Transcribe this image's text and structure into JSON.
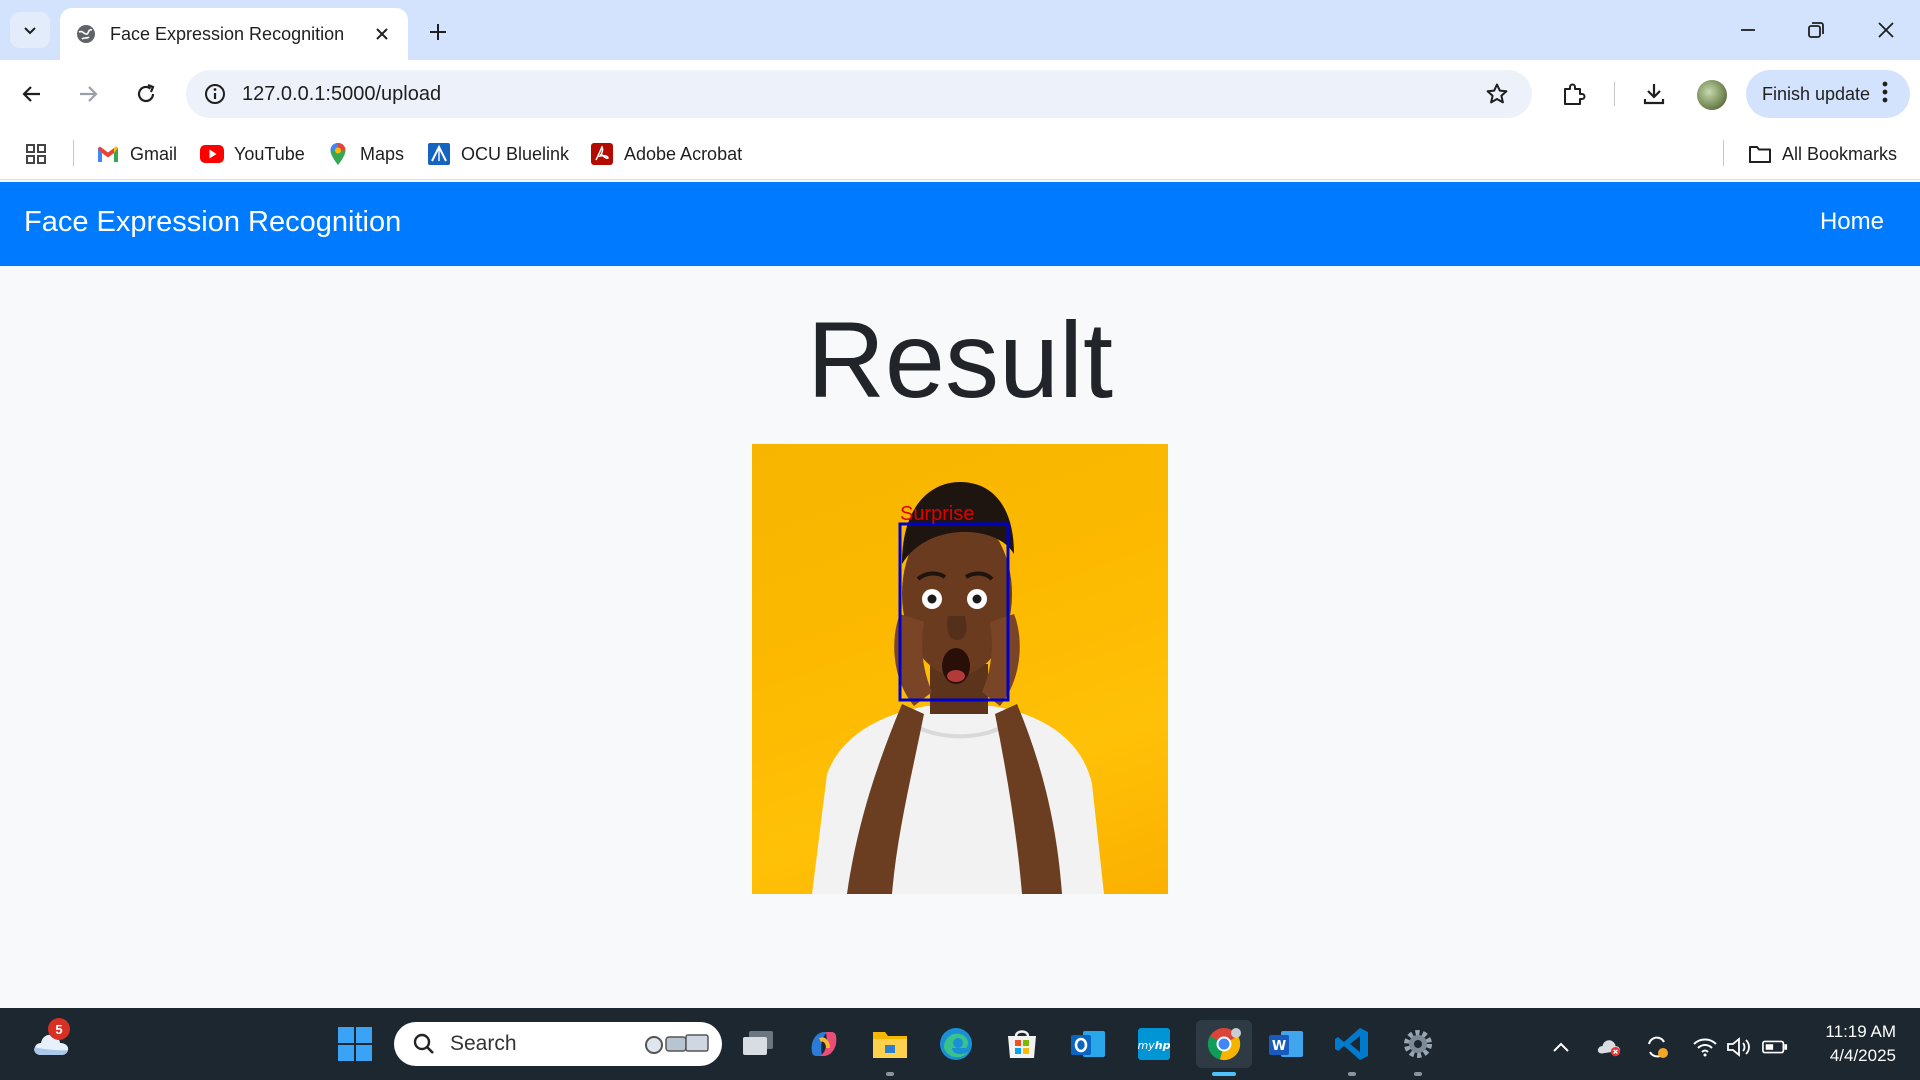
{
  "browser": {
    "tab": {
      "title": "Face Expression Recognition"
    },
    "url": "127.0.0.1:5000/upload",
    "finish_update": "Finish update",
    "bookmarks": [
      {
        "label": "Gmail",
        "icon": "gmail-icon"
      },
      {
        "label": "YouTube",
        "icon": "youtube-icon"
      },
      {
        "label": "Maps",
        "icon": "maps-icon"
      },
      {
        "label": "OCU Bluelink",
        "icon": "ocu-bluelink-icon"
      },
      {
        "label": "Adobe Acrobat",
        "icon": "adobe-acrobat-icon"
      }
    ],
    "all_bookmarks": "All Bookmarks"
  },
  "page": {
    "brand": "Face Expression Recognition",
    "nav_home": "Home",
    "heading": "Result",
    "image": {
      "detection_label": "Surprise",
      "box_color": "#0000cc",
      "label_color": "#e00000"
    }
  },
  "colors": {
    "navbar": "#007bff",
    "tabstrip": "#d3e3fd",
    "taskbar": "#1c2730"
  },
  "taskbar": {
    "search_placeholder": "Search",
    "weather_badge": "5",
    "time": "11:19 AM",
    "date": "4/4/2025"
  }
}
